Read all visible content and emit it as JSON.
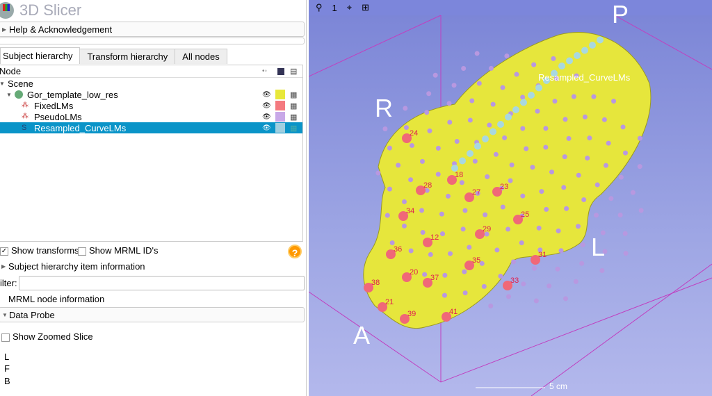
{
  "app": {
    "title": "3D Slicer"
  },
  "sections": {
    "help": "Help & Acknowledgement",
    "sh_info": "Subject hierarchy item information",
    "mrml_info": "MRML node information",
    "data_probe": "Data Probe"
  },
  "tabs": [
    "Subject hierarchy",
    "Transform hierarchy",
    "All nodes"
  ],
  "tree": {
    "header": "Node",
    "rows": [
      {
        "label": "Scene",
        "color": null
      },
      {
        "label": "Gor_template_low_res",
        "color": "#e8e83a"
      },
      {
        "label": "FixedLMs",
        "color": "#f47a80"
      },
      {
        "label": "PseudoLMs",
        "color": "#c8a8e8"
      },
      {
        "label": "Resampled_CurveLMs",
        "color": "#a0cfe0"
      }
    ]
  },
  "options": {
    "show_transforms": "Show transforms",
    "show_ids": "Show MRML ID's",
    "help": "?"
  },
  "filter": {
    "label": "ilter:",
    "value": ""
  },
  "probe": {
    "zoomed": "Show Zoomed Slice",
    "L": "L",
    "F": "F",
    "B": "B"
  },
  "view": {
    "layer": "1",
    "axes": {
      "R": "R",
      "L": "L",
      "A": "A",
      "P": "P"
    },
    "curve_label": "Resampled_CurveLMs",
    "scale": "5 cm",
    "landmarks": [
      "24",
      "18",
      "28",
      "27",
      "23",
      "34",
      "25",
      "29",
      "12",
      "36",
      "35",
      "31",
      "20",
      "37",
      "38",
      "33",
      "21",
      "39",
      "41"
    ]
  }
}
